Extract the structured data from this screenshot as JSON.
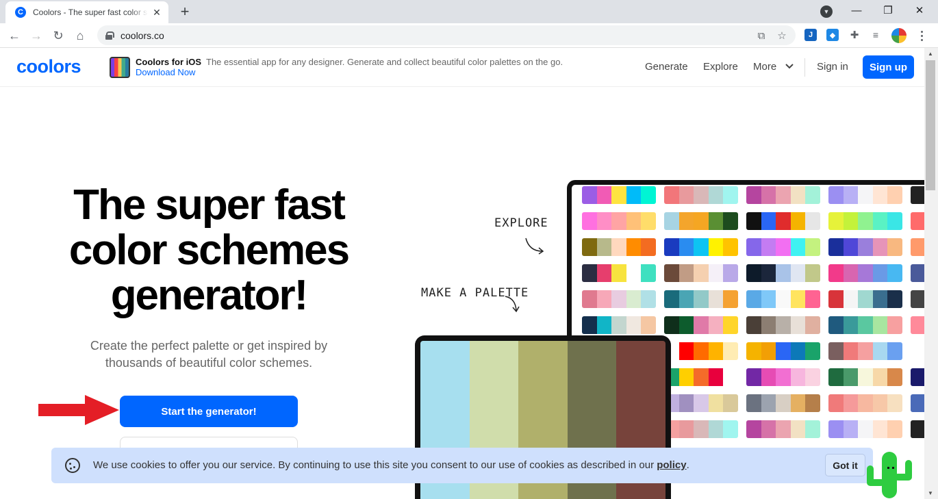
{
  "browser": {
    "tab_title": "Coolors - The super fast color schemes generator!",
    "tab_favicon": "C",
    "new_tab_symbol": "+",
    "url": "coolors.co",
    "window_controls": {
      "minimize": "—",
      "maximize": "❐",
      "close": "✕"
    }
  },
  "header": {
    "logo": "coolors",
    "ios_title": "Coolors for iOS",
    "ios_desc": "The essential app for any designer. Generate and collect beautiful color palettes on the go.",
    "ios_link": "Download Now",
    "nav": {
      "generate": "Generate",
      "explore": "Explore",
      "more": "More",
      "signin": "Sign in",
      "signup": "Sign up"
    }
  },
  "hero": {
    "title_lines": [
      "The super fast",
      "color schemes",
      "generator!"
    ],
    "subtitle_lines": [
      "Create the perfect palette or get inspired by",
      "thousands of beautiful color schemes."
    ],
    "cta": "Start the generator!"
  },
  "illustration": {
    "explore_label": "EXPLORE",
    "palette_label": "MAKE A PALETTE",
    "tablet_colors": [
      "#a7dfef",
      "#d0ddab",
      "#b0b06b",
      "#6f714d",
      "#77433b"
    ],
    "monitor_palettes": [
      [
        [
          "#9b5de5",
          "#f15bb5",
          "#fee440",
          "#00bbf9",
          "#00f5d4"
        ],
        [
          "#ff70e0",
          "#ff8ec6",
          "#ffa4a4",
          "#ffc178",
          "#ffdd6a"
        ],
        [
          "#7f6a10",
          "#b7b98b",
          "#ffd8be",
          "#ff8c00",
          "#f36c21"
        ],
        [
          "#2b2d42",
          "#e63e6d",
          "#f7e33f",
          "#ffffff",
          "#3fe0c0"
        ],
        [
          "#e07a8f",
          "#f7a8b8",
          "#e8cce0",
          "#d9ecd0",
          "#b0e0e6"
        ],
        [
          "#142f4d",
          "#11b5c7",
          "#c3d6cf",
          "#f0e8e0",
          "#f5c7a3"
        ],
        [
          "#ffffff",
          "#ffffff",
          "#ffffff",
          "#ffffff",
          "#ffffff"
        ],
        [
          "#ffffff",
          "#ffffff",
          "#ffffff",
          "#ffffff",
          "#ffffff"
        ],
        [
          "#ffffff",
          "#ffffff",
          "#ffffff",
          "#ffffff",
          "#ffffff"
        ],
        [
          "#ffffff",
          "#ffffff",
          "#ffffff",
          "#ffffff",
          "#ffffff"
        ]
      ],
      [
        [
          "#f2767a",
          "#e89a9d",
          "#d9b8b8",
          "#b0d8d6",
          "#a0f5ef"
        ],
        [
          "#a7d4e3",
          "#f4a52c",
          "#f5a623",
          "#5a8f33",
          "#1d4c1e"
        ],
        [
          "#1a3bbf",
          "#2a8cf0",
          "#0ec4f2",
          "#fff200",
          "#ffc300"
        ],
        [
          "#6b4a3a",
          "#c19c85",
          "#f5d0b0",
          "#f5f0f8",
          "#b9a9e8"
        ],
        [
          "#1a6b7b",
          "#4aa5b4",
          "#92c9c8",
          "#e8e0d8",
          "#f5a232"
        ],
        [
          "#0f2f1b",
          "#0d5c2d",
          "#e07aa8",
          "#f5b0c0",
          "#ffd52a"
        ],
        [
          "#ffffff",
          "#ff0000",
          "#ff6b00",
          "#ffb300",
          "#ffecb3"
        ],
        [
          "#1aa36a",
          "#ffcf00",
          "#f46b2a",
          "#e8003d",
          "#ffffff"
        ],
        [
          "#c0b0e0",
          "#a090c0",
          "#d8c8e8",
          "#f0e0a0",
          "#d9c99a"
        ],
        [
          "#f5a0a0",
          "#e89a9d",
          "#d9b8b8",
          "#b0d8d6",
          "#a0f5ef"
        ]
      ],
      [
        [
          "#b5459f",
          "#d672a8",
          "#eba4b0",
          "#f2e1c3",
          "#a3f2d9"
        ],
        [
          "#111111",
          "#2a66f5",
          "#e02c2c",
          "#f5b400",
          "#e6e6e6"
        ],
        [
          "#8567ea",
          "#c47cf2",
          "#f26ff2",
          "#3ff2f2",
          "#c4f27f"
        ],
        [
          "#0d1b2a",
          "#1b263b",
          "#a9c3e8",
          "#e0e6f2",
          "#c1c88a"
        ],
        [
          "#5aa9e6",
          "#7fc8f8",
          "#f9f9f9",
          "#ffe45e",
          "#ff6392"
        ],
        [
          "#4a3f37",
          "#8c7e72",
          "#b8b0a8",
          "#e8e0d8",
          "#e0b0a0"
        ],
        [
          "#f5b300",
          "#f29f05",
          "#2a66f5",
          "#0d79b8",
          "#1aa36a"
        ],
        [
          "#7228a5",
          "#e64cb4",
          "#f26fd2",
          "#f7b6de",
          "#fad2e1"
        ],
        [
          "#6b7280",
          "#9ca3af",
          "#d8cfc4",
          "#e5b062",
          "#b57f4a"
        ],
        [
          "#b5459f",
          "#d672a8",
          "#eba4b0",
          "#f2e1c3",
          "#a3f2d9"
        ]
      ],
      [
        [
          "#9b8ff2",
          "#b8b0f5",
          "#f5f5f7",
          "#ffe5d4",
          "#ffd0b0"
        ],
        [
          "#e6f23a",
          "#c4f23a",
          "#90f290",
          "#5af2c4",
          "#3ae6e6"
        ],
        [
          "#1a2f9b",
          "#4f47d8",
          "#9a7fdc",
          "#e694b8",
          "#f8b880"
        ],
        [
          "#f23a8a",
          "#d865b0",
          "#a678d8",
          "#6a9ae6",
          "#48b8f2"
        ],
        [
          "#d8343a",
          "#f5f5f5",
          "#a0d8d0",
          "#3a6e8f",
          "#1a2f4a"
        ],
        [
          "#1f5a7e",
          "#3a9a9a",
          "#5ac8a0",
          "#a8e6a0",
          "#f7a0a0"
        ],
        [
          "#7a5f5f",
          "#f07a7a",
          "#f5a0a0",
          "#a8d8f0",
          "#6aa0f0"
        ],
        [
          "#1f6b3f",
          "#4a9a6a",
          "#f7f7dc",
          "#f7d8a8",
          "#d8884a"
        ],
        [
          "#f07a7a",
          "#f59a9a",
          "#f7b8a0",
          "#f7c8a8",
          "#f7e0c0"
        ],
        [
          "#9b8ff2",
          "#b8b0f5",
          "#f5f5f7",
          "#ffe5d4",
          "#ffd0b0"
        ]
      ],
      [
        [
          "#222222"
        ],
        [
          "#ff6b6b"
        ],
        [
          "#ff9a6b"
        ],
        [
          "#4a5a9a"
        ],
        [
          "#444444"
        ],
        [
          "#ff8a9a"
        ],
        [
          "#ffffff"
        ],
        [
          "#1a1a6b"
        ],
        [
          "#4a6ab8"
        ],
        [
          "#222222"
        ]
      ]
    ]
  },
  "cookie": {
    "text": "We use cookies to offer you our service. By continuing to use this site you consent to our use of cookies as described in our",
    "link": "policy",
    "end": ".",
    "button": "Got it"
  },
  "colors": {
    "brand": "#0066ff",
    "cookie_bg": "#cfe0fd",
    "arrow": "#e41e26",
    "cactus": "#2ecc40"
  }
}
